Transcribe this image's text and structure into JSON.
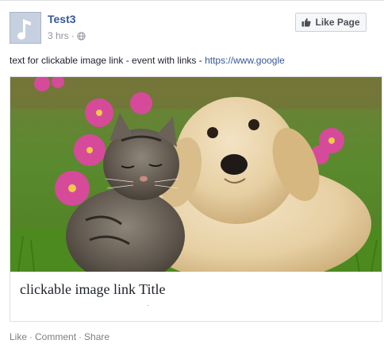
{
  "post": {
    "page_name": "Test3",
    "time": "3 hrs",
    "separator": "·",
    "privacy_icon": "globe-icon",
    "avatar_icon": "music-note-icon",
    "like_page_label": "Like Page",
    "like_icon": "thumbs-up-icon",
    "text": "text for clickable image link - event with links - ",
    "text_link": "https://www.google"
  },
  "link_card": {
    "image_description": "kitten-and-puppy-photo",
    "title": "clickable image link Title",
    "caption": "."
  },
  "actions": {
    "like": "Like",
    "comment": "Comment",
    "share": "Share",
    "separator": "·"
  },
  "colors": {
    "link_blue": "#365899",
    "meta_gray": "#90949c"
  }
}
